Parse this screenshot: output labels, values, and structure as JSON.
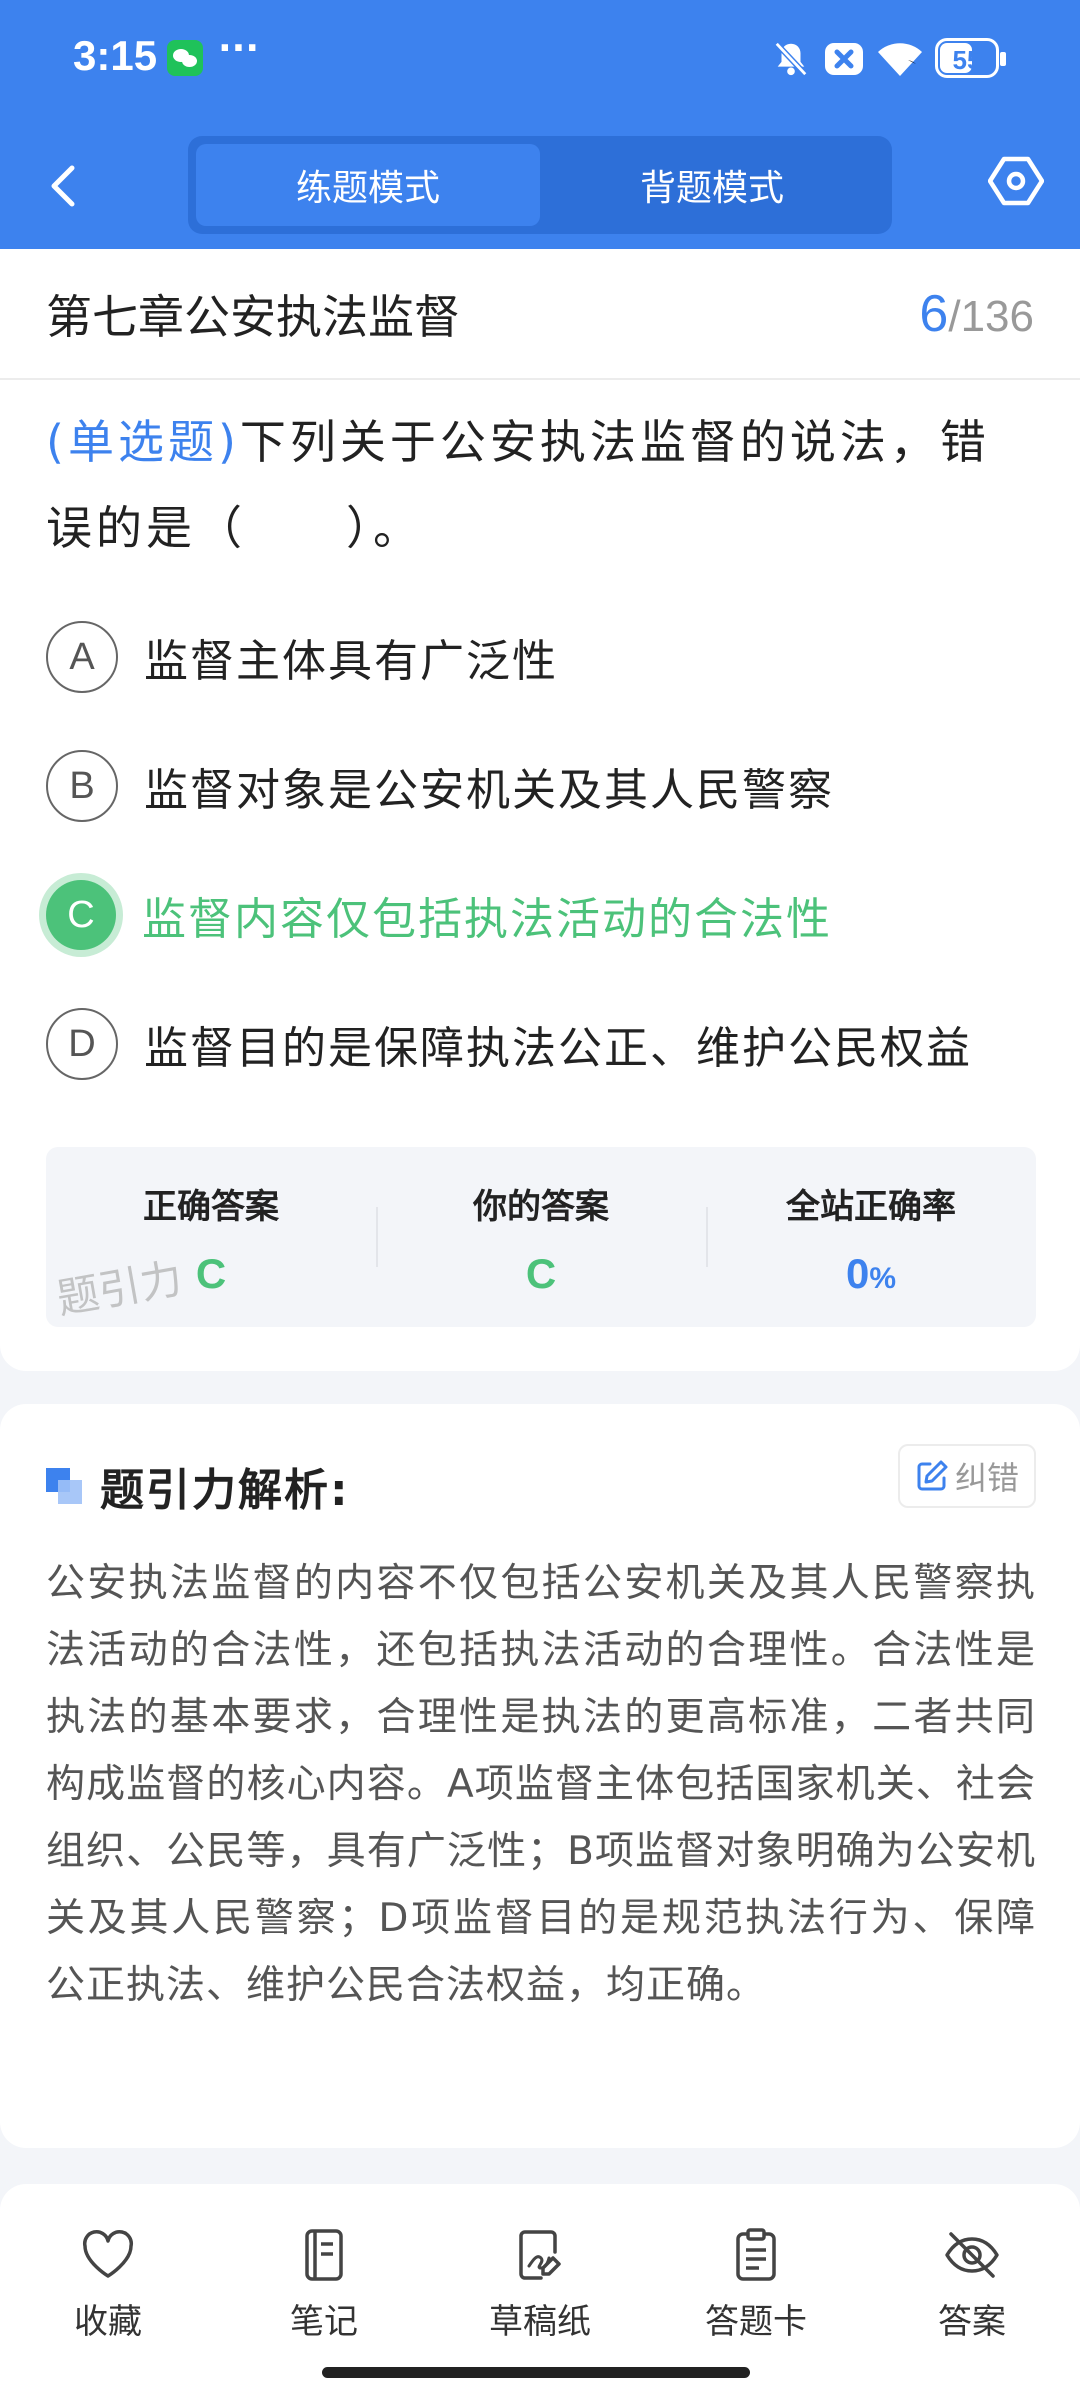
{
  "status_bar": {
    "time": "3:15",
    "more": "···",
    "battery": "55",
    "icons": [
      "wechat-icon",
      "bell-off-icon",
      "close-badge-icon",
      "wifi-icon",
      "battery-icon"
    ]
  },
  "header": {
    "tabs": [
      {
        "label": "练题模式",
        "active": true
      },
      {
        "label": "背题模式",
        "active": false
      }
    ],
    "accent_color": "#3d82ee"
  },
  "question_card": {
    "chapter_title": "第七章公安执法监督",
    "progress_current": "6",
    "progress_separator": "/",
    "progress_total": "136",
    "question_type": "(单选题)",
    "question_text": "下列关于公安执法监督的说法，错误的是（　　）。",
    "options": [
      {
        "letter": "A",
        "text": "监督主体具有广泛性"
      },
      {
        "letter": "B",
        "text": "监督对象是公安机关及其人民警察"
      },
      {
        "letter": "C",
        "text": "监督内容仅包括执法活动的合法性",
        "selected_correct": true
      },
      {
        "letter": "D",
        "text": "监督目的是保障执法公正、维护公民权益"
      }
    ],
    "answer_summary": {
      "correct_label": "正确答案",
      "correct_value": "C",
      "yours_label": "你的答案",
      "yours_value": "C",
      "rate_label": "全站正确率",
      "rate_value": "0",
      "rate_unit": "%"
    },
    "watermark": "题引力"
  },
  "analysis": {
    "title": "题引力解析:",
    "fix_button": "纠错",
    "body": "公安执法监督的内容不仅包括公安机关及其人民警察执法活动的合法性，还包括执法活动的合理性。合法性是执法的基本要求，合理性是执法的更高标准，二者共同构成监督的核心内容。A项监督主体包括国家机关、社会组织、公民等，具有广泛性；B项监督对象明确为公安机关及其人民警察；D项监督目的是规范执法行为、保障公正执法、维护公民合法权益，均正确。"
  },
  "toolbar": {
    "items": [
      {
        "label": "收藏",
        "icon": "heart-icon"
      },
      {
        "label": "笔记",
        "icon": "notebook-icon"
      },
      {
        "label": "草稿纸",
        "icon": "draft-paper-icon"
      },
      {
        "label": "答题卡",
        "icon": "answer-card-icon"
      },
      {
        "label": "答案",
        "icon": "eye-off-icon"
      }
    ]
  }
}
